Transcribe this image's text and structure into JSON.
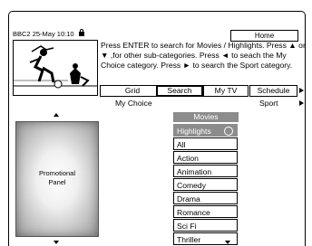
{
  "header": {
    "channel": "BBC2",
    "datetime": "25-May 10:10",
    "home_label": "Home"
  },
  "instructions": "Press ENTER to search for Movies / Highlights. Press ▲ or ▼ ,for other sub-categories. Press ◄ to seach the My Choice category. Press ► to search the Sport category.",
  "tabs": [
    {
      "label": "Grid"
    },
    {
      "label": "Search",
      "selected": true
    },
    {
      "label": "My TV"
    },
    {
      "label": "Schedule"
    }
  ],
  "sub_categories": {
    "left": "My Choice",
    "right": "Sport"
  },
  "promo_panel": {
    "line1": "Promotional",
    "line2": "Panel"
  },
  "category_list": {
    "header": "Movies",
    "items": [
      {
        "label": "Highlights",
        "highlighted": true
      },
      {
        "label": "All"
      },
      {
        "label": "Action"
      },
      {
        "label": "Animation"
      },
      {
        "label": "Comedy"
      },
      {
        "label": "Drama"
      },
      {
        "label": "Romance"
      },
      {
        "label": "Sci Fi"
      },
      {
        "label": "Thriller"
      }
    ]
  },
  "colors": {
    "highlight": "#8c8c8c",
    "text": "#000000",
    "background": "#ffffff"
  }
}
